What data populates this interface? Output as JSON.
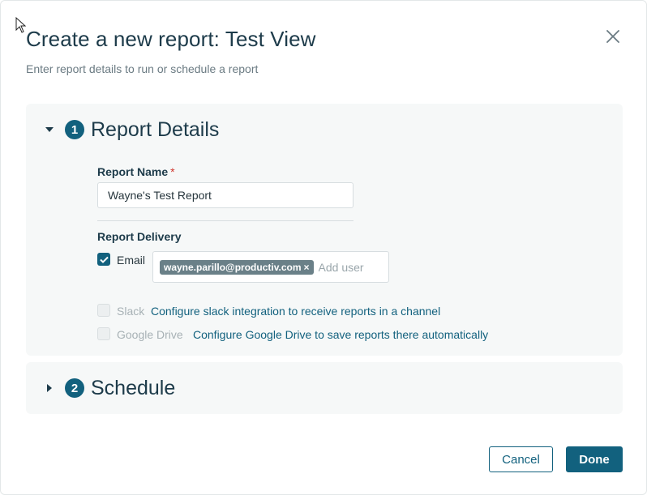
{
  "dialog": {
    "title": "Create a new report: Test View",
    "subtitle": "Enter report details to run or schedule a report",
    "close_icon": "close-icon"
  },
  "details_section": {
    "step": "1",
    "title": "Report Details",
    "expanded": true,
    "report_name_label": "Report Name",
    "required_marker": "*",
    "report_name_value": "Wayne's Test Report",
    "delivery_label": "Report Delivery",
    "email": {
      "label": "Email",
      "checked": true,
      "recipient": "wayne.parillo@productiv.com",
      "chip_remove": "×",
      "add_placeholder": "Add user"
    },
    "slack": {
      "label": "Slack",
      "checked": false,
      "enabled": false,
      "link": "Configure slack integration to receive reports in a channel"
    },
    "google_drive": {
      "label": "Google Drive",
      "checked": false,
      "enabled": false,
      "link": "Configure Google Drive to save reports there automatically"
    }
  },
  "schedule_section": {
    "step": "2",
    "title": "Schedule",
    "expanded": false
  },
  "footer": {
    "cancel_label": "Cancel",
    "done_label": "Done"
  },
  "colors": {
    "accent": "#12617e",
    "heading": "#1d3b4a",
    "section_bg": "#f6f8f8",
    "chip_bg": "#6a8088",
    "required": "#d0342c"
  }
}
